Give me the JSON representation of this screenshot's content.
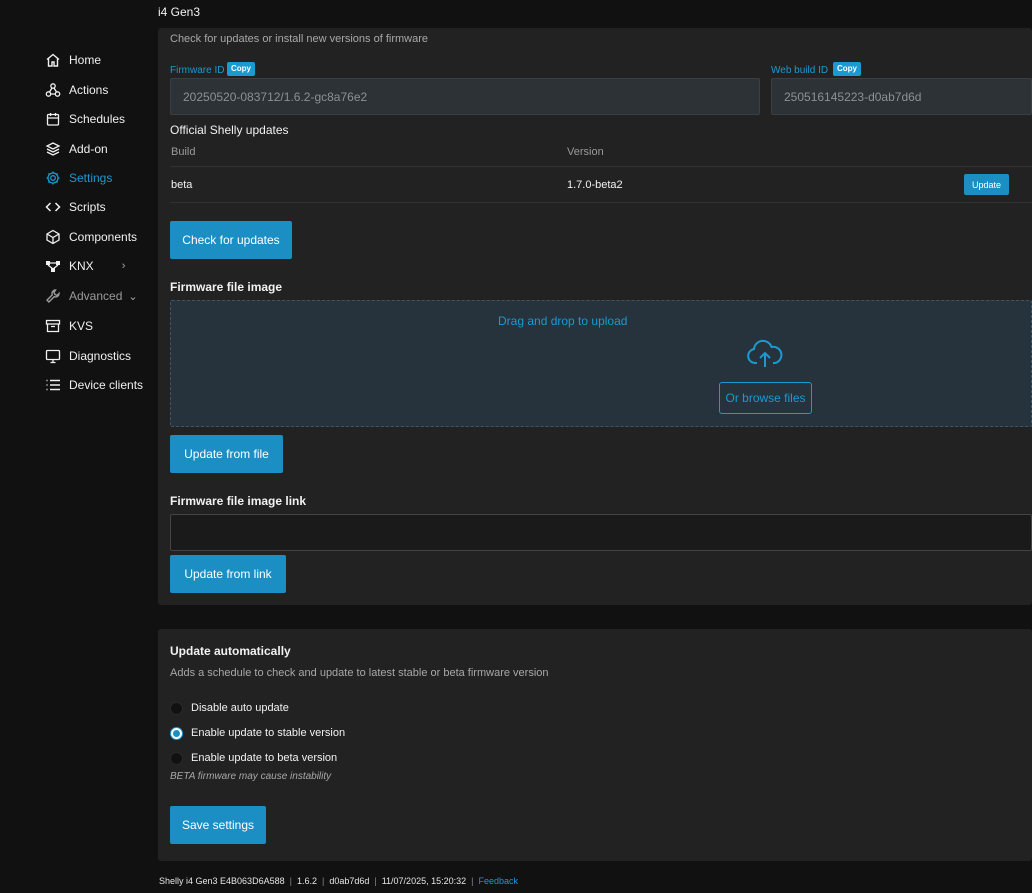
{
  "device_title": "i4 Gen3",
  "sidebar": {
    "items": [
      {
        "label": "Home",
        "icon": "home-icon"
      },
      {
        "label": "Actions",
        "icon": "actions-icon"
      },
      {
        "label": "Schedules",
        "icon": "calendar-icon"
      },
      {
        "label": "Add-on",
        "icon": "layers-icon"
      },
      {
        "label": "Settings",
        "icon": "gear-icon",
        "active": true
      },
      {
        "label": "Scripts",
        "icon": "code-icon"
      },
      {
        "label": "Components",
        "icon": "cube-icon"
      },
      {
        "label": "KNX",
        "icon": "network-icon",
        "chevron": "›"
      },
      {
        "label": "Advanced",
        "icon": "wrench-icon",
        "chevron": "⌄"
      },
      {
        "label": "KVS",
        "icon": "archive-icon"
      },
      {
        "label": "Diagnostics",
        "icon": "monitor-icon"
      },
      {
        "label": "Device clients",
        "icon": "list-icon"
      }
    ]
  },
  "firmware": {
    "subtitle": "Check for updates or install new versions of firmware",
    "firmware_id_label": "Firmware ID",
    "firmware_id_value": "20250520-083712/1.6.2-gc8a76e2",
    "web_build_id_label": "Web build ID",
    "web_build_id_value": "250516145223-d0ab7d6d",
    "copy_label": "Copy",
    "official_heading": "Official Shelly updates",
    "table": {
      "headers": [
        "Build",
        "Version"
      ],
      "rows": [
        {
          "build": "beta",
          "version": "1.7.0-beta2",
          "action": "Update"
        }
      ]
    },
    "check_button": "Check for updates",
    "file_image_heading": "Firmware file image",
    "dropzone_text": "Drag and drop to upload",
    "browse_button": "Or browse files",
    "update_file_button": "Update from file",
    "link_heading": "Firmware file image link",
    "link_value": "",
    "update_link_button": "Update from link"
  },
  "auto_update": {
    "heading": "Update automatically",
    "subtitle": "Adds a schedule to check and update to latest stable or beta firmware version",
    "options": [
      {
        "label": "Disable auto update",
        "checked": false
      },
      {
        "label": "Enable update to stable version",
        "checked": true
      },
      {
        "label": "Enable update to beta version",
        "checked": false
      }
    ],
    "note": "BETA firmware may cause instability",
    "save_button": "Save settings"
  },
  "footer": {
    "device": "Shelly i4 Gen3 E4B063D6A588",
    "version": "1.6.2",
    "build": "d0ab7d6d",
    "datetime": "11/07/2025, 15:20:32",
    "feedback": "Feedback"
  },
  "colors": {
    "accent": "#1b9ad1",
    "button": "#1b8fc4",
    "background": "#111111",
    "card": "#222222"
  }
}
